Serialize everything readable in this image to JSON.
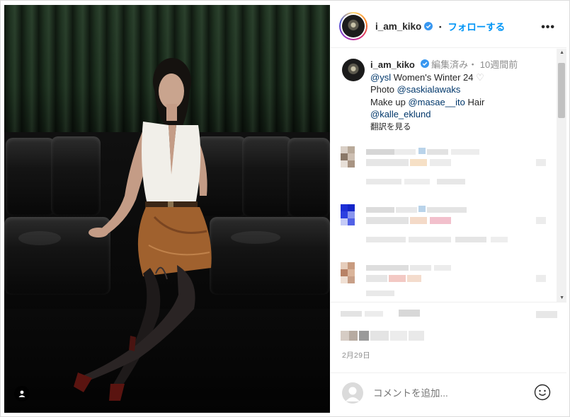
{
  "post": {
    "username": "i_am_kiko",
    "follow_label": "フォローする",
    "separator": "・",
    "more_label": "•••"
  },
  "caption": {
    "username": "i_am_kiko",
    "meta": "編集済み・ 10週間前",
    "line1_mention": "@ysl",
    "line1_text": " Women's Winter 24 ",
    "line1_heart": "♡",
    "line2_text": "Photo ",
    "line2_mention": "@saskialawaks",
    "line3_text": "Make up ",
    "line3_mention": "@masae__ito",
    "line3_suffix": " Hair",
    "line4_mention": "@kalle_eklund",
    "translate_label": "翻訳を見る"
  },
  "date_label": "2月29日",
  "comment_placeholder": "コメントを追加...",
  "colors": {
    "accent": "#0095f6",
    "mention": "#00376b",
    "muted": "#8e8e8e",
    "verified": "#3897f0"
  },
  "icons": {
    "verified": "verified-badge-icon",
    "more": "more-options-icon",
    "user_tag": "user-tag-icon",
    "emoji": "emoji-icon",
    "heart": "heart-outline-icon"
  }
}
